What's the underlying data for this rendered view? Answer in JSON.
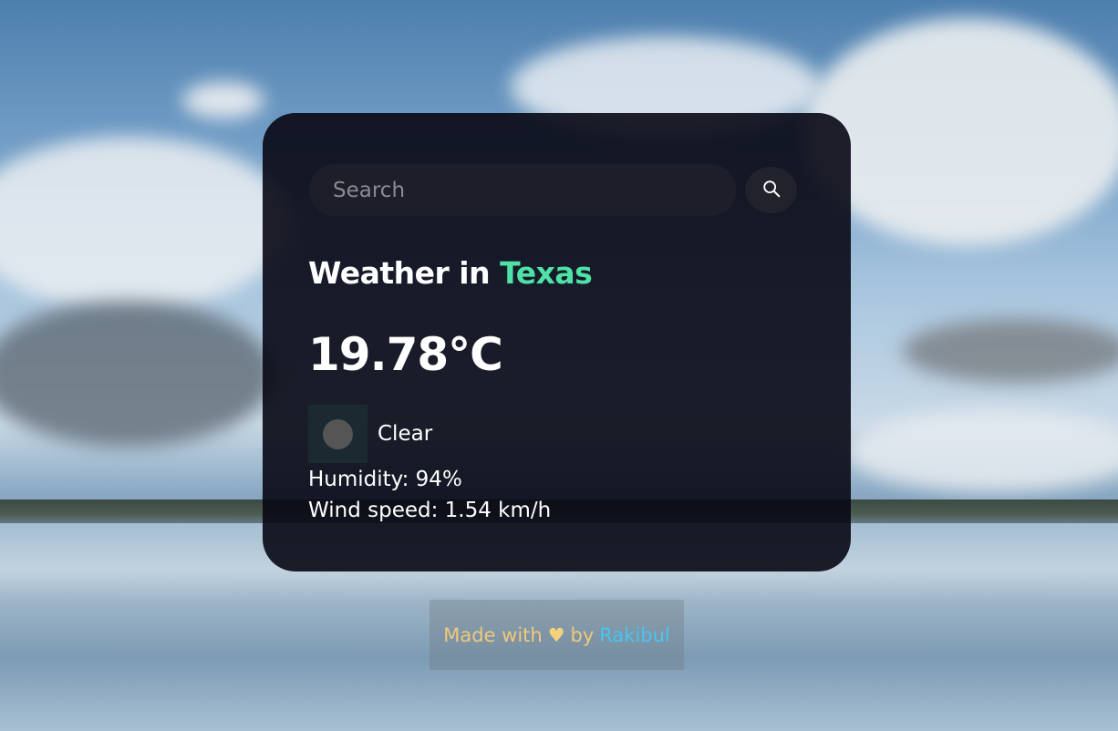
{
  "search": {
    "placeholder": "Search",
    "value": ""
  },
  "weather": {
    "title_prefix": "Weather in",
    "city": "Texas",
    "temperature": "19.78°C",
    "condition": "Clear",
    "humidity": "Humidity: 94%",
    "wind_speed": "Wind speed: 1.54 km/h"
  },
  "footer": {
    "made_with": "Made with",
    "heart": "♥",
    "by": "by",
    "author": "Rakibul"
  },
  "icons": {
    "search": "search-icon",
    "condition": "weather-condition-icon",
    "heart": "heart-icon"
  },
  "colors": {
    "city_accent": "#4ee2a6",
    "footer_text": "#f0c97a",
    "author_link": "#46c6f2",
    "card_background": "#080814"
  }
}
